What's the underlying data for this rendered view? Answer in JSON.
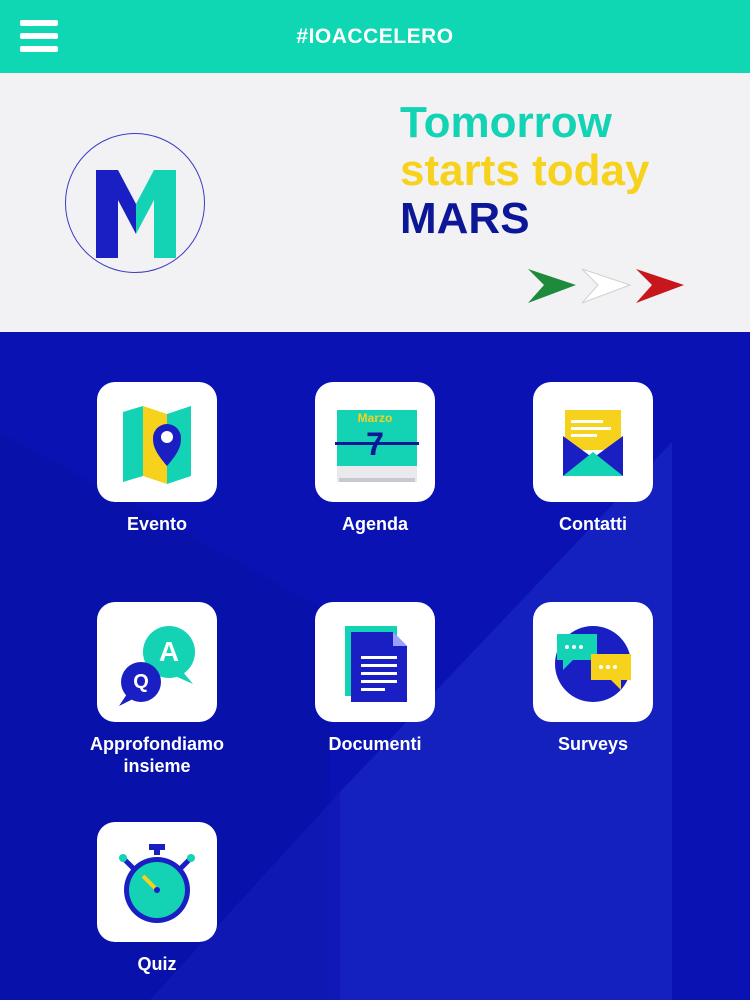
{
  "header": {
    "title": "#IOACCELERO",
    "menu_icon": "hamburger-menu-icon"
  },
  "banner": {
    "logo_letter": "M",
    "tagline_line1": "Tomorrow",
    "tagline_line2": "starts today",
    "tagline_line3": "MARS"
  },
  "tiles": [
    {
      "label": "Evento",
      "icon": "map-pin-icon"
    },
    {
      "label": "Agenda",
      "icon": "calendar-icon",
      "calendar_month": "Marzo",
      "calendar_day": "7"
    },
    {
      "label": "Contatti",
      "icon": "envelope-icon"
    },
    {
      "label": "Approfondiamo insieme",
      "icon": "qa-bubbles-icon",
      "bubble_a": "A",
      "bubble_q": "Q"
    },
    {
      "label": "Documenti",
      "icon": "document-icon"
    },
    {
      "label": "Surveys",
      "icon": "chat-bubbles-icon"
    },
    {
      "label": "Quiz",
      "icon": "stopwatch-icon"
    }
  ],
  "colors": {
    "header_bg": "#0fd7b4",
    "main_bg": "#0b12b4",
    "accent_teal": "#14d2b4",
    "accent_yellow": "#f7d21c",
    "navy": "#0b1796"
  }
}
